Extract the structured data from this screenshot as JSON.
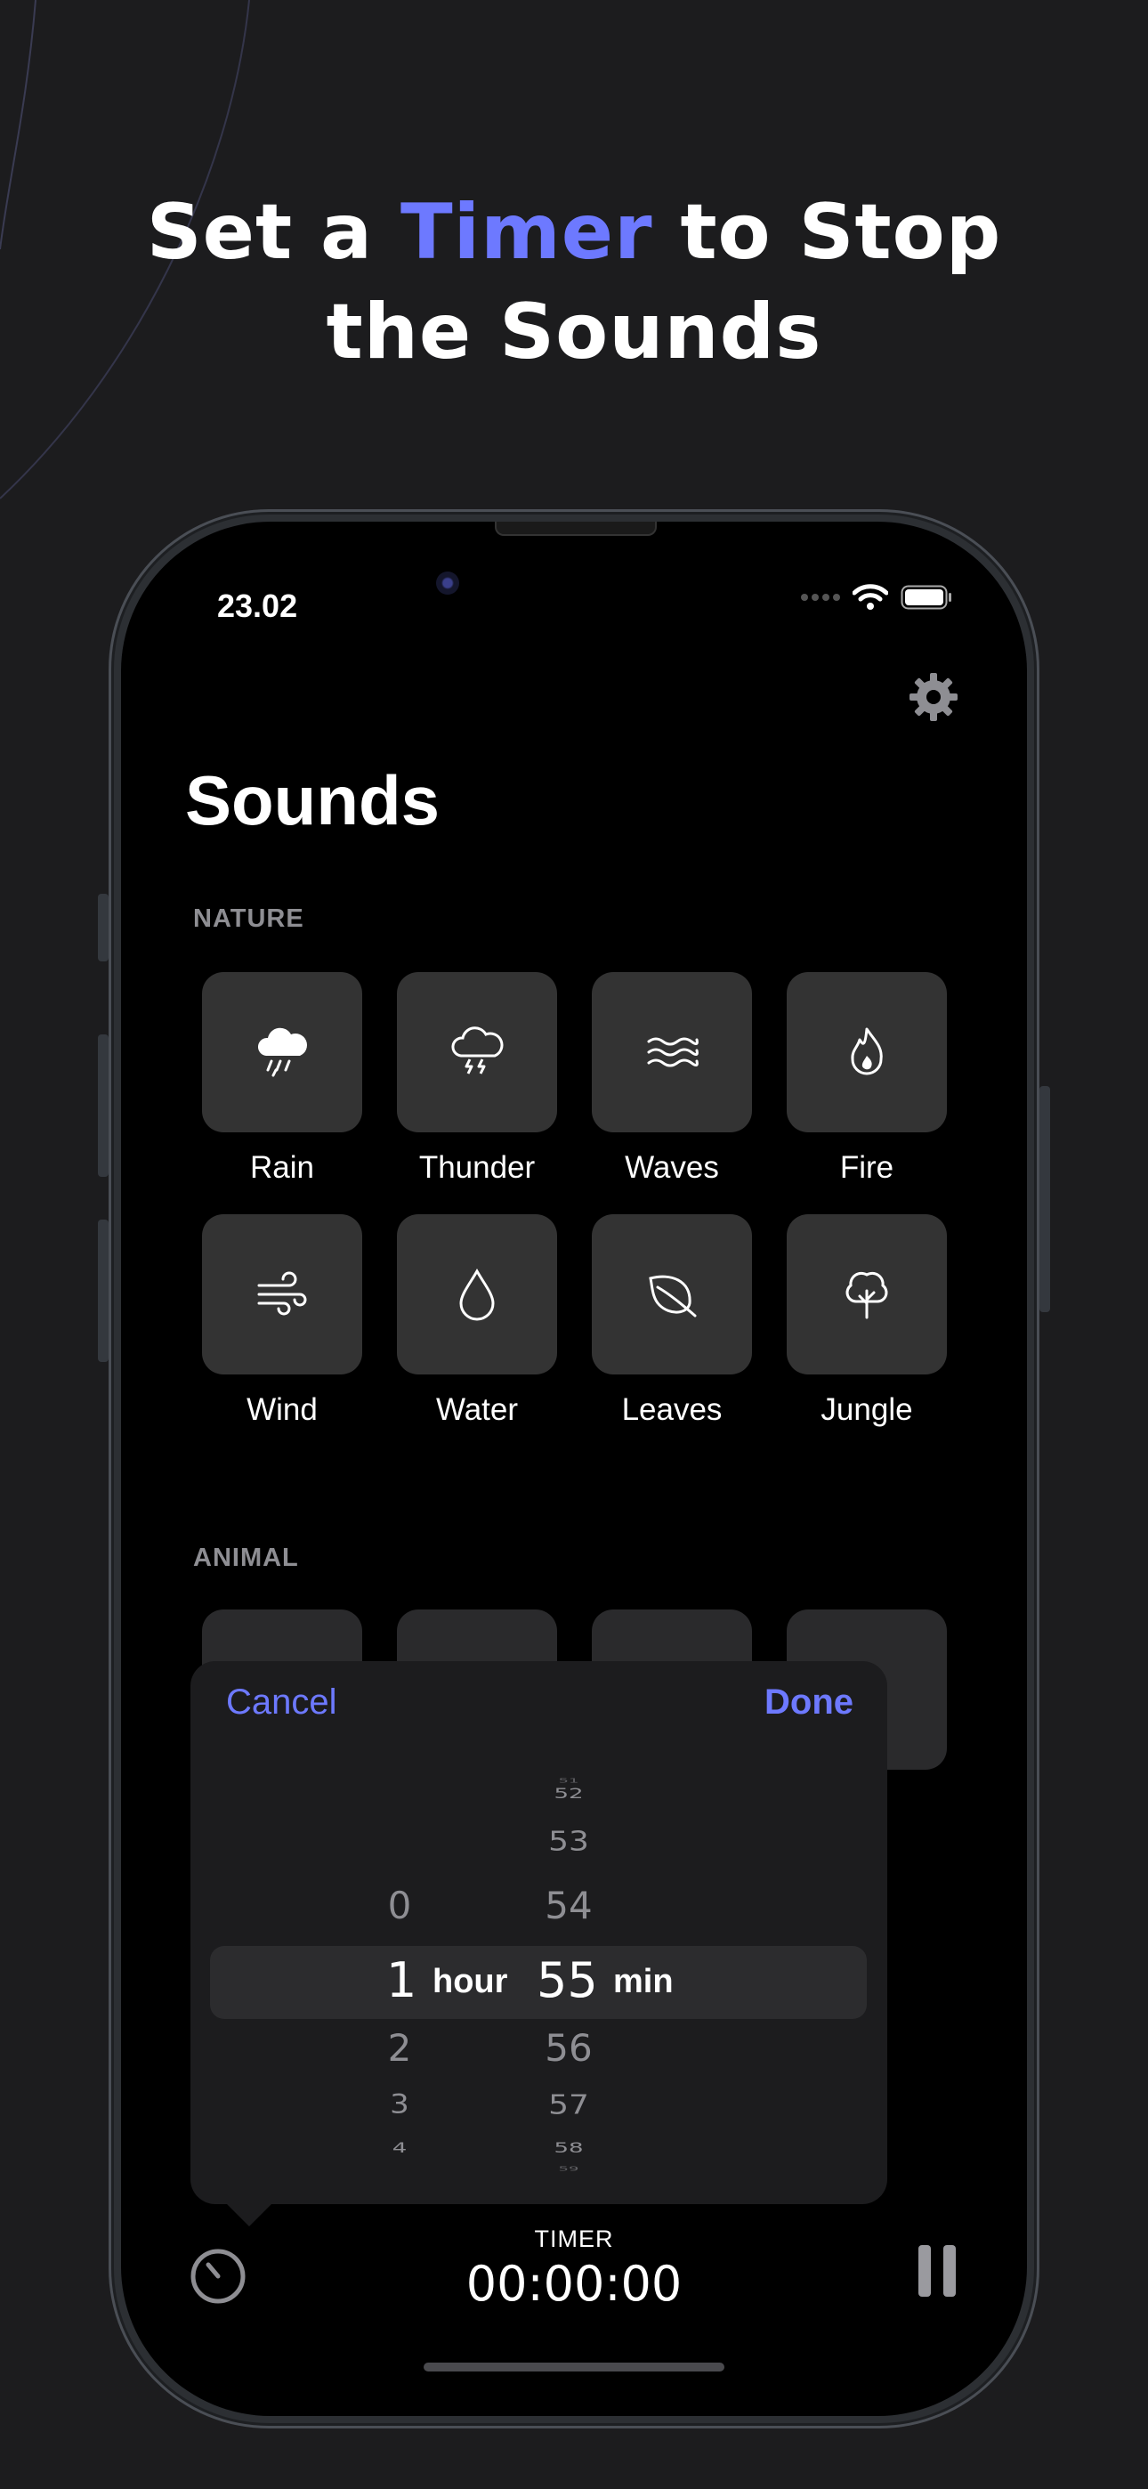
{
  "headline": {
    "before": "Set a ",
    "accent": "Timer",
    "after": " to Stop",
    "line2": "the Sounds"
  },
  "status_bar": {
    "time": "23.02"
  },
  "page_title": "Sounds",
  "sections": {
    "nature": {
      "label": "NATURE",
      "items": [
        {
          "label": "Rain",
          "icon": "cloud-rain-icon"
        },
        {
          "label": "Thunder",
          "icon": "cloud-bolt-icon"
        },
        {
          "label": "Waves",
          "icon": "waves-icon"
        },
        {
          "label": "Fire",
          "icon": "flame-icon"
        },
        {
          "label": "Wind",
          "icon": "wind-icon"
        },
        {
          "label": "Water",
          "icon": "drop-icon"
        },
        {
          "label": "Leaves",
          "icon": "leaf-icon"
        },
        {
          "label": "Jungle",
          "icon": "tree-icon"
        }
      ]
    },
    "animal": {
      "label": "ANIMAL"
    }
  },
  "picker": {
    "cancel_label": "Cancel",
    "done_label": "Done",
    "hours_above": [
      "0"
    ],
    "hours_below": [
      "2",
      "3",
      "4"
    ],
    "minutes_above": [
      "51",
      "52",
      "53",
      "54"
    ],
    "minutes_below": [
      "56",
      "57",
      "58",
      "59"
    ],
    "selected_hour": "1",
    "hour_unit": "hour",
    "selected_minute": "55",
    "minute_unit": "min"
  },
  "timer_bar": {
    "label": "TIMER",
    "value": "00:00:00"
  },
  "colors": {
    "accent": "#6d79ff",
    "background": "#1c1c1e",
    "tile": "#333333"
  }
}
